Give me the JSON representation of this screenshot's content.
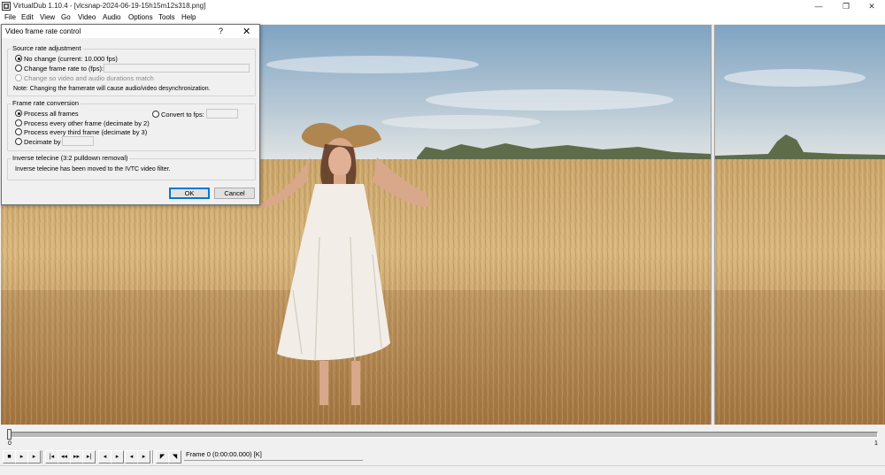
{
  "window": {
    "title": "VirtualDub 1.10.4 - [vlcsnap-2024-06-19-15h15m12s318.png]",
    "minimize_glyph": "—",
    "maximize_glyph": "❐",
    "close_glyph": "✕"
  },
  "menu": [
    "File",
    "Edit",
    "View",
    "Go",
    "Video",
    "Audio",
    "Options",
    "Tools",
    "Help"
  ],
  "dialog": {
    "title": "Video frame rate control",
    "help_glyph": "?",
    "close_glyph": "✕",
    "source_group": {
      "label": "Source rate adjustment",
      "options": [
        {
          "label": "No change (current: 10.000 fps)",
          "selected": true,
          "disabled": false
        },
        {
          "label": "Change frame rate to (fps):",
          "selected": false,
          "disabled": false
        },
        {
          "label": "Change so video and audio durations match",
          "selected": false,
          "disabled": true
        }
      ],
      "fps_value": "",
      "note": "Note: Changing the framerate will cause audio/video desynchronization."
    },
    "conversion_group": {
      "label": "Frame rate conversion",
      "options": [
        {
          "label": "Process all frames",
          "selected": true
        },
        {
          "label": "Process every other frame (decimate by 2)",
          "selected": false
        },
        {
          "label": "Process every third frame (decimate by 3)",
          "selected": false
        },
        {
          "label": "Decimate by",
          "selected": false
        }
      ],
      "convert_label": "Convert to fps:",
      "convert_value": "",
      "decimate_value": ""
    },
    "ivtc_group": {
      "label": "Inverse telecine (3:2 pulldown removal)",
      "text": "Inverse telecine has been moved to the IVTC video filter."
    },
    "ok_label": "OK",
    "cancel_label": "Cancel"
  },
  "timeline": {
    "start_label": "0",
    "end_label": "1",
    "position": 0
  },
  "toolbar": {
    "buttons": [
      {
        "name": "stop-button",
        "glyph": "■"
      },
      {
        "name": "play-input-button",
        "glyph": "▸"
      },
      {
        "name": "play-output-button",
        "glyph": "▸"
      },
      {
        "name": "go-start-button",
        "glyph": "|◂"
      },
      {
        "name": "step-back-button",
        "glyph": "◂◂"
      },
      {
        "name": "step-forward-button",
        "glyph": "▸▸"
      },
      {
        "name": "go-end-button",
        "glyph": "▸|"
      },
      {
        "name": "prev-key-button",
        "glyph": "◂"
      },
      {
        "name": "next-key-button",
        "glyph": "▸"
      },
      {
        "name": "scene-back-button",
        "glyph": "◂"
      },
      {
        "name": "scene-forward-button",
        "glyph": "▸"
      },
      {
        "name": "mark-in-button",
        "glyph": "◤"
      },
      {
        "name": "mark-out-button",
        "glyph": "◥"
      }
    ],
    "frame_status": "Frame 0 (0:00:00.000) [K]"
  },
  "colors": {
    "sky_top": "#8fb0cc",
    "sky_bottom": "#d9dfe2",
    "field_light": "#d9b780",
    "field_dark": "#9a6a38",
    "dress": "#f2ede6",
    "accent": "#0078d7"
  }
}
